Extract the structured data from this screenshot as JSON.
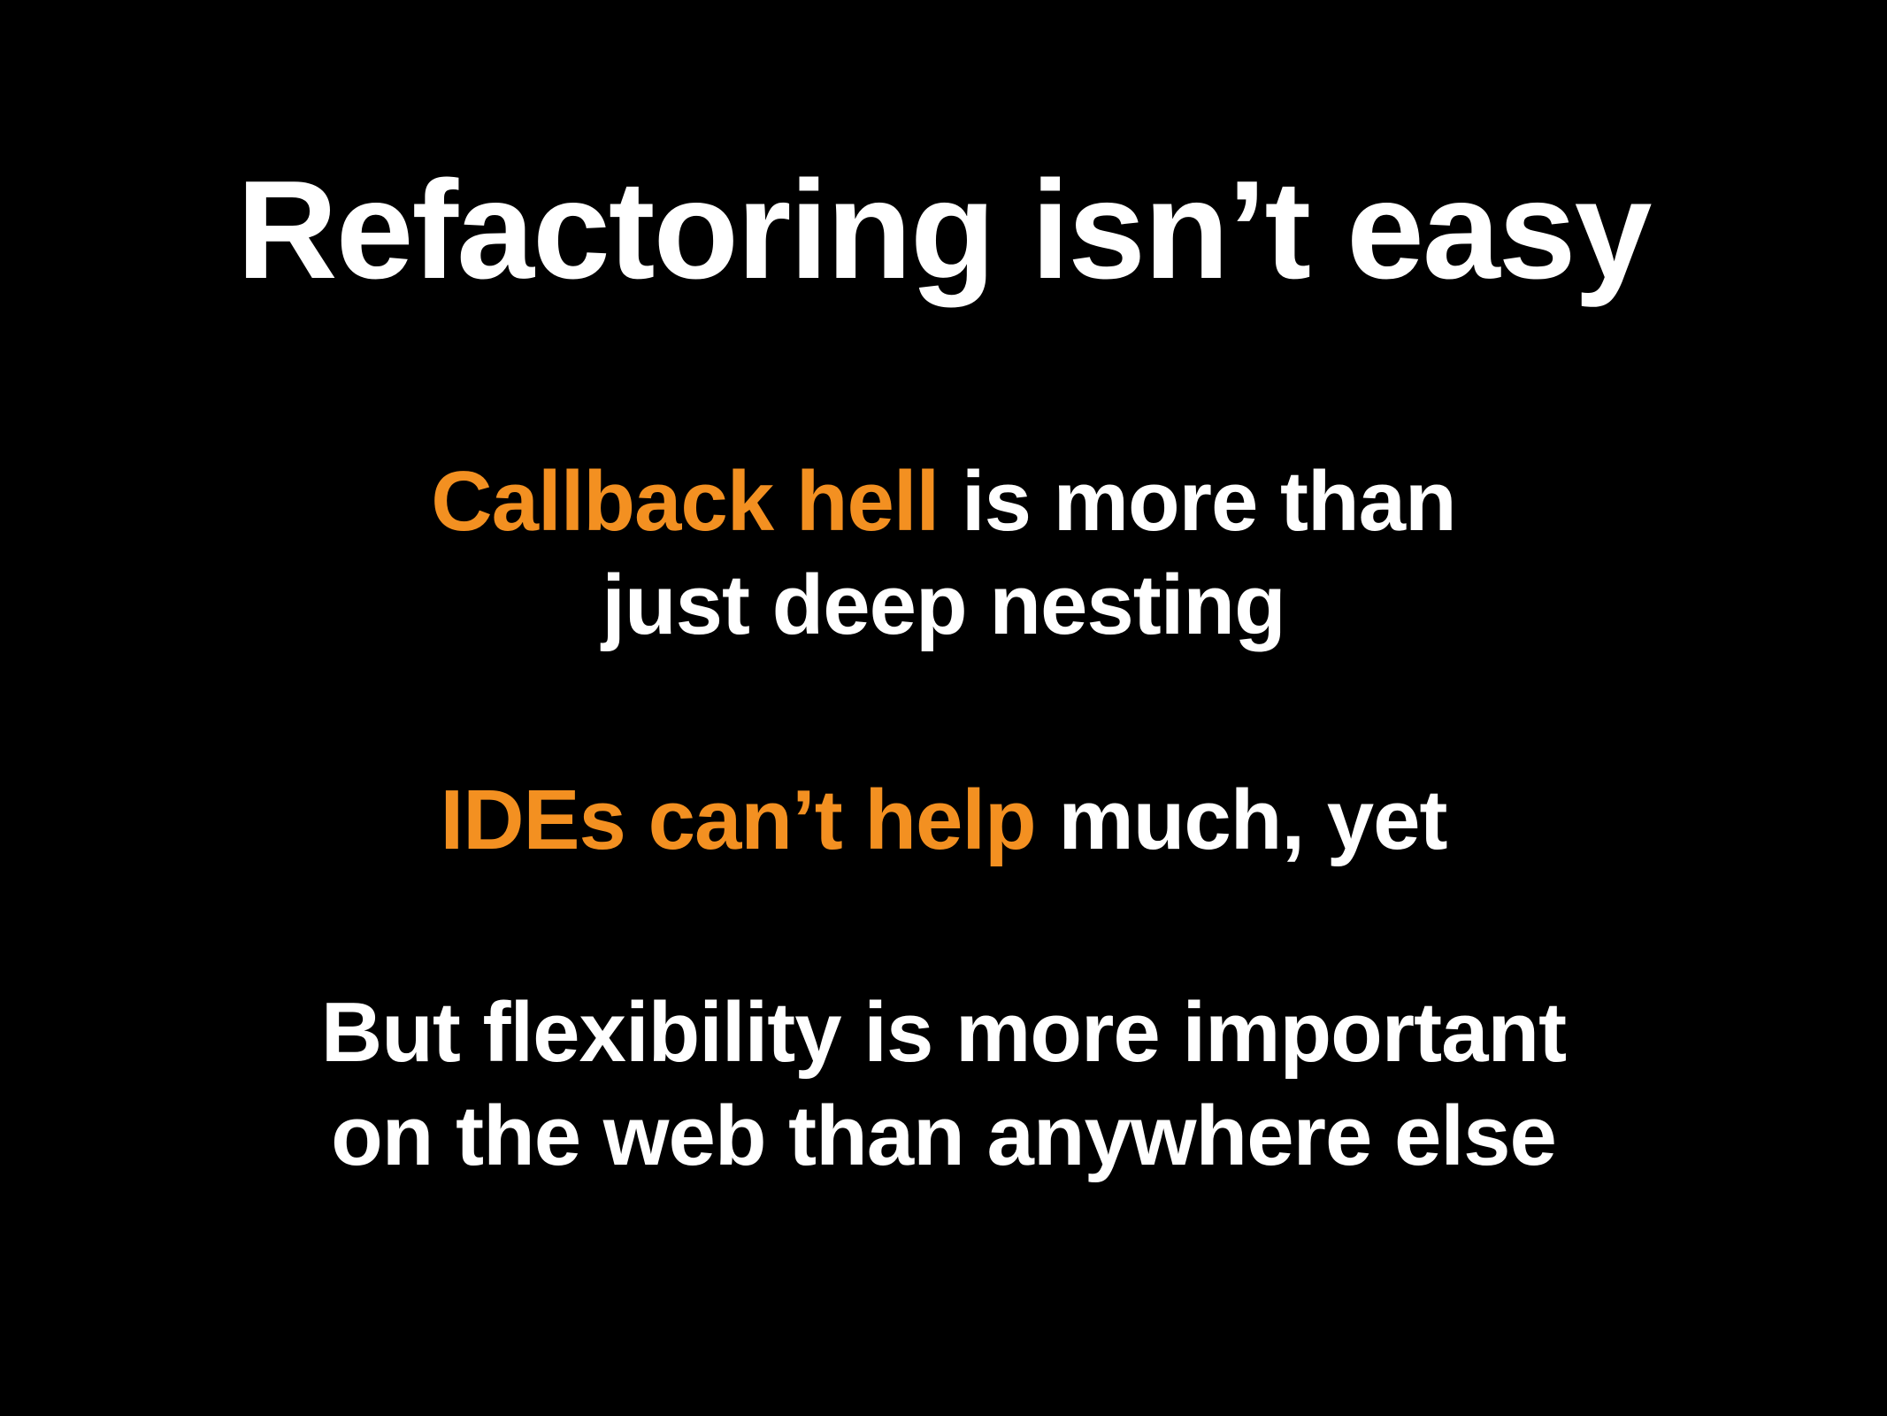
{
  "colors": {
    "background": "#000000",
    "text": "#FFFFFF",
    "accent": "#F39021"
  },
  "slide": {
    "title": "Refactoring isn’t easy",
    "points": [
      {
        "line1_accent": "Callback hell",
        "line1_rest": " is more than",
        "line2": "just deep nesting"
      },
      {
        "line1_accent": "IDEs can’t help",
        "line1_rest": " much, yet"
      },
      {
        "line1": "But flexibility is more important",
        "line2": "on the web than anywhere else"
      }
    ]
  }
}
